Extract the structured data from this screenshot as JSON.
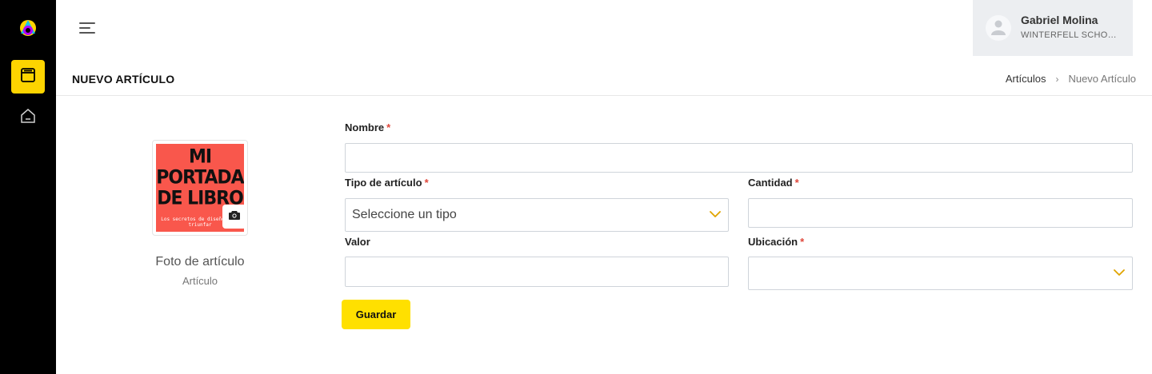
{
  "user": {
    "name": "Gabriel Molina",
    "school": "WINTERFELL SCHOOL..."
  },
  "page": {
    "title": "NUEVO ARTÍCULO"
  },
  "breadcrumb": {
    "parent": "Artículos",
    "separator": "›",
    "current": "Nuevo Artículo"
  },
  "photo": {
    "cover_lines": [
      "MI",
      "PORTADA",
      "DE LIBRO"
    ],
    "cover_sub": "Los secretos de diseño para triunfar",
    "label": "Foto de artículo",
    "sublabel": "Artículo"
  },
  "form": {
    "nombre": {
      "label": "Nombre",
      "required": "*",
      "value": ""
    },
    "tipo": {
      "label": "Tipo de artículo",
      "required": "*",
      "selected": "Seleccione un tipo"
    },
    "cantidad": {
      "label": "Cantidad",
      "required": "*",
      "value": ""
    },
    "valor": {
      "label": "Valor",
      "value": ""
    },
    "ubicacion": {
      "label": "Ubicación",
      "required": "*",
      "selected": ""
    },
    "save_label": "Guardar"
  },
  "colors": {
    "accent": "#fdd400",
    "sidebar": "#000000",
    "required": "#e0473b",
    "chevron": "#e0a400"
  },
  "icons": [
    "app-logo-icon",
    "book-icon",
    "home-icon",
    "menu-icon",
    "user-icon",
    "camera-icon",
    "chevron-down-icon"
  ]
}
